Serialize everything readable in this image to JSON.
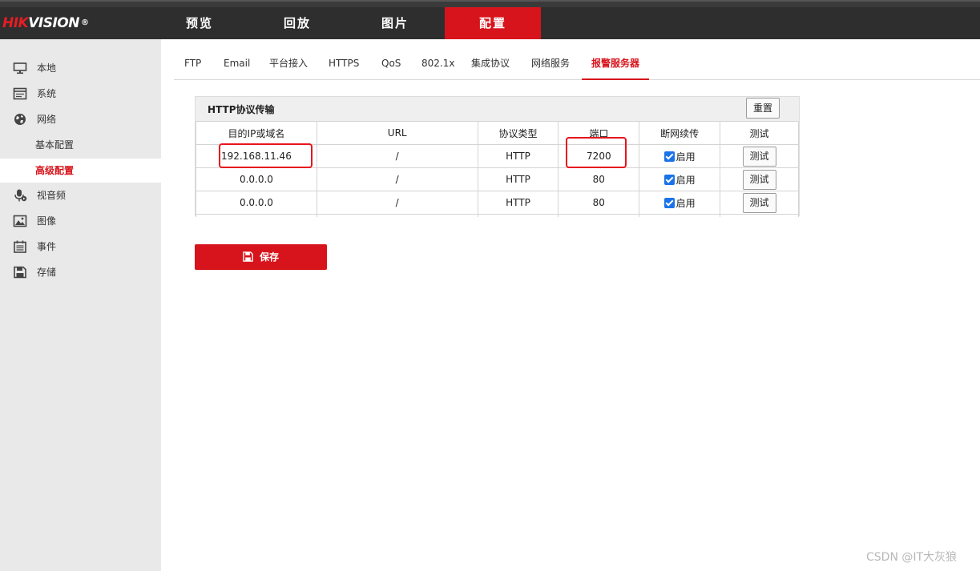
{
  "logo": {
    "part1": "HIK",
    "part2": "VISION",
    "reg": "®"
  },
  "topnav": {
    "items": [
      "预览",
      "回放",
      "图片",
      "配置"
    ],
    "active": "配置"
  },
  "sidebar": {
    "items": [
      {
        "label": "本地",
        "icon": "monitor-icon"
      },
      {
        "label": "系统",
        "icon": "system-window-icon"
      },
      {
        "label": "网络",
        "icon": "globe-icon"
      },
      {
        "label": "视音频",
        "icon": "microphone-icon"
      },
      {
        "label": "图像",
        "icon": "image-icon"
      },
      {
        "label": "事件",
        "icon": "calendar-icon"
      },
      {
        "label": "存储",
        "icon": "floppy-disk-icon"
      }
    ],
    "subitems": [
      "基本配置",
      "高级配置"
    ],
    "active_sub": "高级配置"
  },
  "tabs": {
    "items": [
      "FTP",
      "Email",
      "平台接入",
      "HTTPS",
      "QoS",
      "802.1x",
      "集成协议",
      "网络服务",
      "报警服务器"
    ],
    "active": "报警服务器"
  },
  "panel": {
    "title": "HTTP协议传输",
    "reset_label": "重置",
    "columns": [
      "目的IP或域名",
      "URL",
      "协议类型",
      "端口",
      "断网续传",
      "测试"
    ],
    "rows": [
      {
        "ip": "192.168.11.46",
        "url": "/",
        "protocol": "HTTP",
        "port": "7200",
        "resume_checked": true,
        "resume_label": "启用",
        "test_label": "测试"
      },
      {
        "ip": "0.0.0.0",
        "url": "/",
        "protocol": "HTTP",
        "port": "80",
        "resume_checked": true,
        "resume_label": "启用",
        "test_label": "测试"
      },
      {
        "ip": "0.0.0.0",
        "url": "/",
        "protocol": "HTTP",
        "port": "80",
        "resume_checked": true,
        "resume_label": "启用",
        "test_label": "测试"
      }
    ]
  },
  "save_label": "保存",
  "watermark": "CSDN @IT大灰狼",
  "colors": {
    "accent": "#d7141c",
    "header_bg": "#2e2e2e",
    "sidebar_bg": "#e9e9e9",
    "checkbox": "#1a73e8",
    "highlight_box": "#e8141c"
  }
}
